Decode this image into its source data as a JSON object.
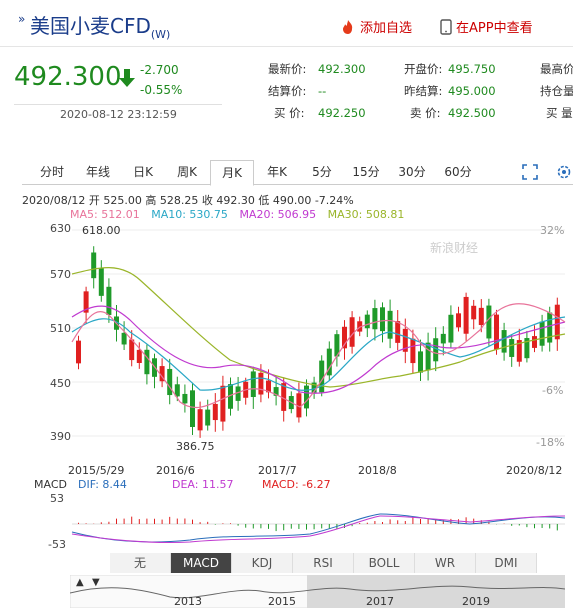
{
  "header": {
    "symbol_mark": "»",
    "title": "美国小麦CFD",
    "title_suffix": "(W)",
    "add_favorite": "添加自选",
    "app_view": "在APP中查看"
  },
  "quote": {
    "price": "492.300",
    "change": "-2.700",
    "change_pct": "-0.55%",
    "timestamp": "2020-08-12 23:12:59",
    "rows": [
      {
        "l1": "最新价:",
        "v1": "492.300",
        "l2": "开盘价:",
        "v2": "495.750",
        "l3": "最高价"
      },
      {
        "l1": "结算价:",
        "v1": "--",
        "l2": "昨结算:",
        "v2": "495.000",
        "l3": "持仓量"
      },
      {
        "l1": "买 价:",
        "v1": "492.250",
        "l2": "卖 价:",
        "v2": "492.500",
        "l3": "买 量"
      }
    ]
  },
  "tabs": [
    "分时",
    "年线",
    "日K",
    "周K",
    "月K",
    "年K",
    "5分",
    "15分",
    "30分",
    "60分"
  ],
  "active_tab": "月K",
  "kline_info": "2020/08/12 开 525.00 高 528.25 收 492.30 低 490.00 -7.24%",
  "ma": [
    {
      "label": "MA5: 512.01",
      "color": "#e8739a"
    },
    {
      "label": "MA10: 530.75",
      "color": "#2aa7c6"
    },
    {
      "label": "MA20: 506.95",
      "color": "#c03ad0"
    },
    {
      "label": "MA30: 508.81",
      "color": "#9ab52a"
    }
  ],
  "watermark": "新浪财经",
  "chart_data": {
    "type": "candlestick",
    "y_ticks": [
      "630",
      "570",
      "510",
      "450",
      "390"
    ],
    "right_ticks": [
      "32%",
      "-6%",
      "-18%"
    ],
    "x_ticks": [
      "2015/5/29",
      "2016/6",
      "2017/7",
      "2018/8",
      "2020/8/12"
    ],
    "annotations": [
      "618.00",
      "386.75"
    ],
    "macd": {
      "label": "MACD",
      "dif": "DIF: 8.44",
      "dea": "DEA: 11.57",
      "macd": "MACD: -6.27",
      "y_top": "53",
      "y_bottom": "-53"
    }
  },
  "indicators": [
    "无",
    "MACD",
    "KDJ",
    "RSI",
    "BOLL",
    "WR",
    "DMI"
  ],
  "active_indicator": "MACD",
  "navigator": {
    "years": [
      "2013",
      "2015",
      "2017",
      "2019"
    ]
  },
  "colors": {
    "up": "#e02020",
    "down": "#1f9a2a"
  }
}
